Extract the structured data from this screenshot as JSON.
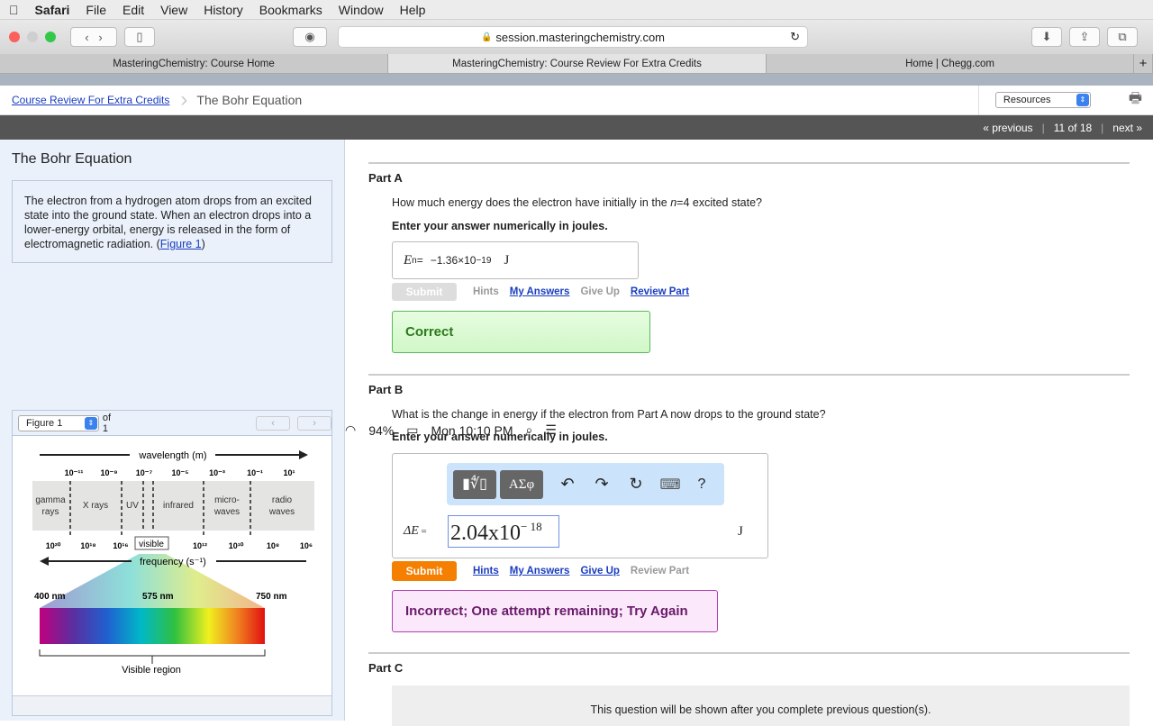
{
  "menubar": {
    "apple": "",
    "app": "Safari",
    "items": [
      "File",
      "Edit",
      "View",
      "History",
      "Bookmarks",
      "Window",
      "Help"
    ],
    "battery": "94%",
    "clock": "Mon 10:10 PM"
  },
  "browser": {
    "url": "session.masteringchemistry.com",
    "tabs": [
      "MasteringChemistry: Course Home",
      "MasteringChemistry: Course Review For Extra Credits",
      "Home | Chegg.com"
    ],
    "new_tab": "+"
  },
  "breadcrumb": {
    "link": "Course Review For Extra Credits",
    "current": "The Bohr Equation",
    "resources": "Resources"
  },
  "pager": {
    "previous": "« previous",
    "position": "11 of 18",
    "next": "next »"
  },
  "left": {
    "title": "The Bohr Equation",
    "intro": "The electron from a hydrogen atom drops from an excited state into the ground state. When an electron drops into a lower-energy orbital, energy is released in the form of electromagnetic radiation. (",
    "figure_link": "Figure 1",
    "intro_end": ")",
    "figure_select": "Figure 1",
    "of": "of 1",
    "figure": {
      "wavelength": "wavelength (m)",
      "frequency": "frequency (s⁻¹)",
      "wl_ticks": [
        "10⁻¹¹",
        "10⁻⁹",
        "10⁻⁷",
        "10⁻⁵",
        "10⁻³",
        "10⁻¹",
        "10¹"
      ],
      "fq_ticks": [
        "10²⁰",
        "10¹⁸",
        "10¹⁶",
        "10¹²",
        "10¹⁰",
        "10⁸",
        "10⁶"
      ],
      "regions": [
        "gamma",
        "rays",
        "X rays",
        "UV",
        "infrared",
        "micro-",
        "waves",
        "radio",
        "waves"
      ],
      "visible": "visible",
      "nm": [
        "400 nm",
        "575 nm",
        "750 nm"
      ],
      "visible_region": "Visible region"
    }
  },
  "partA": {
    "label": "Part A",
    "question_pre": "How much energy does the electron have initially in the ",
    "n": "n",
    "question_post": "=4 excited state?",
    "instruction": "Enter your answer numerically in joules.",
    "var": "E",
    "sub": "n",
    "eq": " = ",
    "answer": "−1.36×10",
    "exp": "−19",
    "unit": "J",
    "submit": "Submit",
    "hints": "Hints",
    "my_answers": "My Answers",
    "give_up": "Give Up",
    "review": "Review Part",
    "feedback": "Correct"
  },
  "partB": {
    "label": "Part B",
    "question": "What is the change in energy if the electron from Part A now drops to the ground state?",
    "instruction": "Enter your answer numerically in joules.",
    "toolbar": {
      "templates": "▮∜▯",
      "greek": "ΑΣφ",
      "undo": "↶",
      "redo": "↷",
      "reset": "↻",
      "keyboard": "⌨",
      "help": "?"
    },
    "var": "ΔE",
    "eq": " = ",
    "answer": "2.04x10",
    "exp": "− 18",
    "unit": "J",
    "submit": "Submit",
    "hints": "Hints",
    "my_answers": "My Answers",
    "give_up": "Give Up",
    "review": "Review Part",
    "feedback": "Incorrect; One attempt remaining; Try Again"
  },
  "partC": {
    "label": "Part C",
    "locked": "This question will be shown after you complete previous question(s)."
  }
}
